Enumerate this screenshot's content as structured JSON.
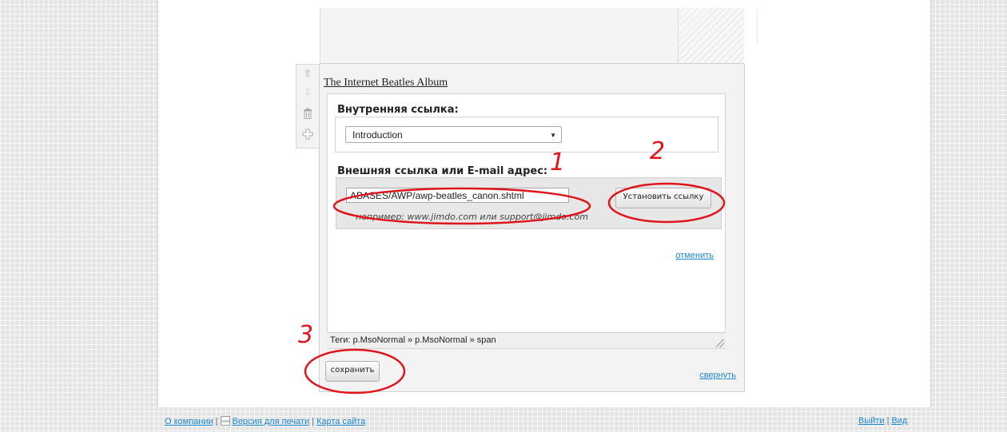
{
  "editor": {
    "title": "The Internet Beatles Album",
    "internal_link": {
      "label": "Внутренняя ссылка:",
      "selected": "Introduction"
    },
    "external_link": {
      "label": "Внешняя ссылка или E-mail адрес:",
      "value": "ABASES/AWP/awp-beatles_canon.shtml",
      "example": "например: www.jimdo.com или support@jimdo.com",
      "set_button": "Установить ссылку"
    },
    "cancel": "отменить",
    "status_bar": "Теги: p.MsoNormal » p.MsoNormal » span",
    "save_button": "сохранить",
    "collapse": "свернуть"
  },
  "annotations": {
    "n1": "1",
    "n2": "2",
    "n3": "3",
    "color": "#e0141b"
  },
  "footer": {
    "about": "О компании",
    "print_version": "Версия для печати",
    "sitemap": "Карта сайта",
    "logout": "Выйти",
    "view": "Вид"
  },
  "toolbar_icons": [
    "arrow-up-icon",
    "arrow-down-icon",
    "trash-icon",
    "add-icon"
  ]
}
